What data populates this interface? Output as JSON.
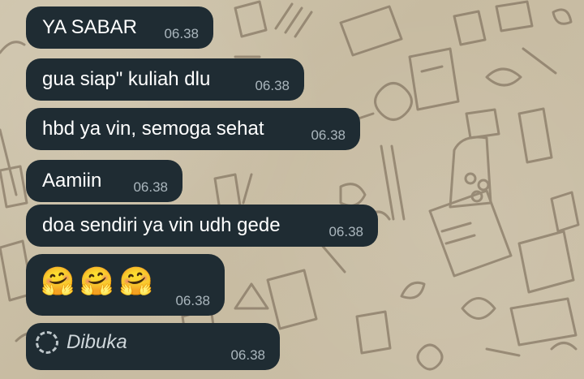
{
  "messages": [
    {
      "text": "YA SABAR",
      "time": "06.38"
    },
    {
      "text": "gua siap\" kuliah dlu",
      "time": "06.38"
    },
    {
      "text": "hbd ya vin, semoga sehat",
      "time": "06.38"
    },
    {
      "text": "Aamiin",
      "time": "06.38"
    },
    {
      "text": "doa sendiri ya vin udh gede",
      "time": "06.38"
    },
    {
      "emojis": [
        "🤗",
        "🤗",
        "🤗"
      ],
      "emoji_name": "hugging-face-emoji",
      "time": "06.38"
    },
    {
      "text": "Dibuka",
      "icon": "loading-circle-icon",
      "time": "06.38"
    }
  ],
  "colors": {
    "bubble": "#1f2c33",
    "text": "#ffffff",
    "time": "#aab6bd",
    "wallpaper": "#cbbfa6"
  }
}
